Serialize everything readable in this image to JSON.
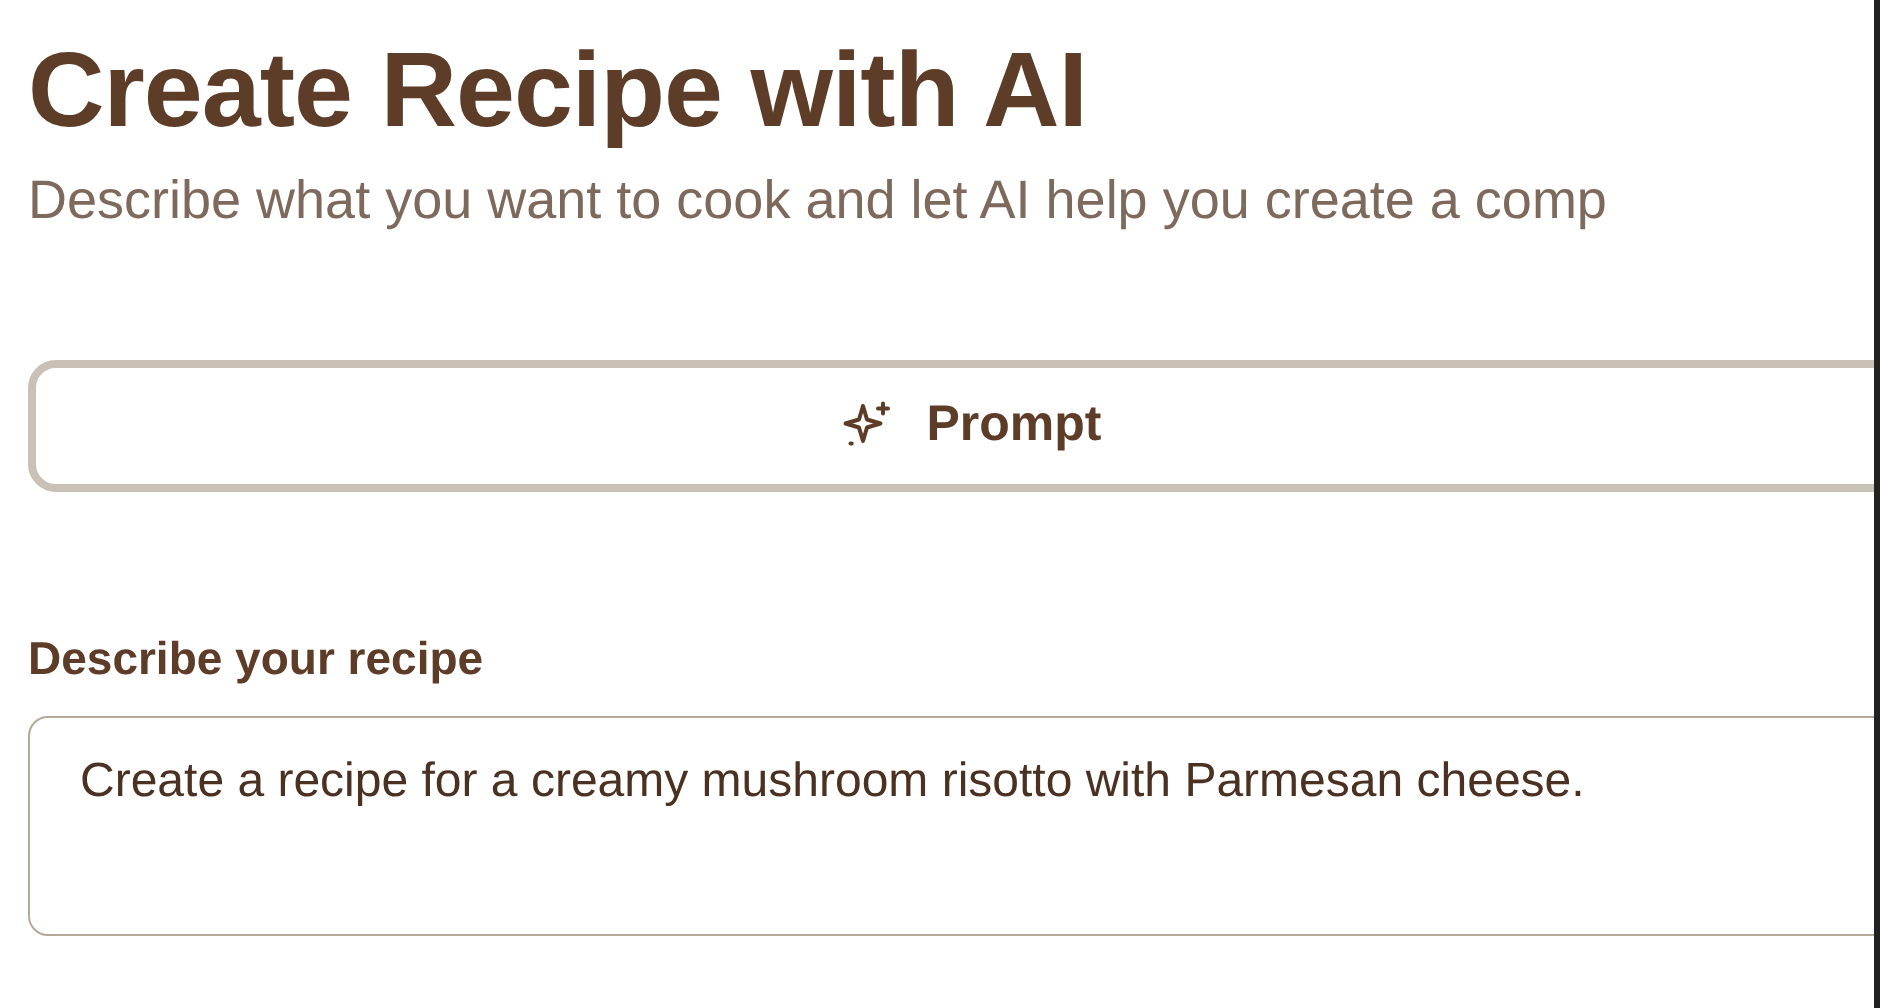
{
  "title": "Create Recipe with AI",
  "subtitle": "Describe what you want to cook and let AI help you create a comp",
  "mode_button": {
    "label": "Prompt"
  },
  "recipe_field": {
    "label": "Describe your recipe",
    "value": "Create a recipe for a creamy mushroom risotto with Parmesan cheese."
  }
}
